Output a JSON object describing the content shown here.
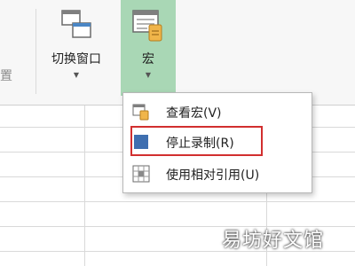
{
  "ribbon": {
    "partial_group_label": "置",
    "switch_windows_label": "切换窗口",
    "macros_label": "宏"
  },
  "macro_menu": {
    "items": [
      {
        "label": "查看宏(V)",
        "icon": "view-macros-icon"
      },
      {
        "label": "停止录制(R)",
        "icon": "stop-recording-icon"
      },
      {
        "label": "使用相对引用(U)",
        "icon": "relative-reference-icon"
      }
    ]
  },
  "colors": {
    "macros_button_active": "#a9d7b5",
    "highlight": "#d22f2f",
    "stop_icon": "#3f6fb0"
  },
  "watermark": "易坊好文馆"
}
